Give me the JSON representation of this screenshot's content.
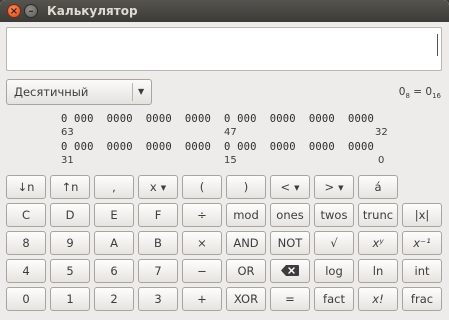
{
  "window": {
    "title": "Калькулятор",
    "close_glyph": "×",
    "minimize_glyph": "–"
  },
  "display": {
    "value": ""
  },
  "mode_select": {
    "value": "Десятичный",
    "arrow": "▼"
  },
  "base_info": {
    "text": "0₈ = 0₁₆"
  },
  "bits": {
    "row1": "0 000  0000  0000  0000  0 000  0000  0000  0000",
    "row2": "0 000  0000  0000  0000  0 000  0000  0000  0000",
    "labels_row1": [
      "63",
      "47",
      "32"
    ],
    "labels_row2": [
      "31",
      "15",
      "0"
    ]
  },
  "buttons": [
    [
      "↓n",
      "↑n",
      ",",
      "x",
      "(",
      ")",
      "<",
      ">",
      "á"
    ],
    [
      "C",
      "D",
      "E",
      "F",
      "÷",
      "mod",
      "ones",
      "twos",
      "trunc",
      "|x|"
    ],
    [
      "8",
      "9",
      "A",
      "B",
      "×",
      "AND",
      "NOT",
      "√",
      "xʸ",
      "x⁻¹"
    ],
    [
      "4",
      "5",
      "6",
      "7",
      "−",
      "OR",
      "backspace",
      "log",
      "ln",
      "int"
    ],
    [
      "0",
      "1",
      "2",
      "3",
      "+",
      "XOR",
      "=",
      "fact",
      "x!",
      "frac"
    ]
  ],
  "dropdown_arrow": "▼",
  "colors": {
    "titlebar": "#3c3b37",
    "window_bg": "#edeceb",
    "close_button": "#df4a16"
  }
}
